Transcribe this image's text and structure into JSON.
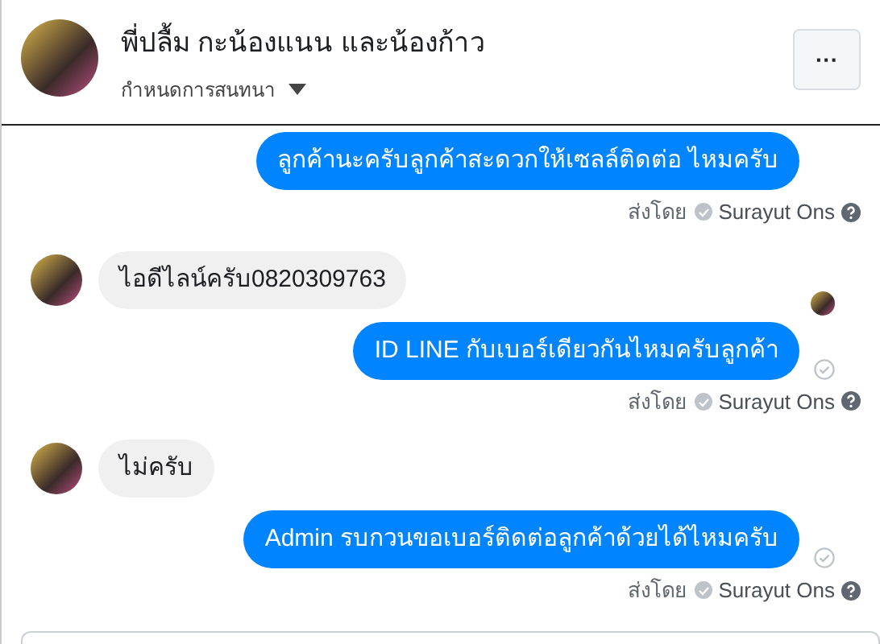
{
  "header": {
    "title": "พี่ปลื้ม กะน้องแนน และน้องก้าว",
    "subtitle": "กำหนดการสนทนา",
    "more_label": "···"
  },
  "messages": [
    {
      "kind": "outgoing",
      "text": "ลูกค้านะครับลูกค้าสะดวกให้เซลล์ติดต่อ ไหมครับ",
      "delivered": false,
      "sent_by": {
        "label": "ส่งโดย",
        "name": "Surayut Ons"
      }
    },
    {
      "kind": "incoming",
      "text": "ไอดีไลน์ครับ0820309763",
      "seen_avatar": true
    },
    {
      "kind": "outgoing",
      "text": "ID LINE กับเบอร์เดียวกันไหมครับลูกค้า",
      "delivered": true,
      "sent_by": {
        "label": "ส่งโดย",
        "name": "Surayut Ons"
      }
    },
    {
      "kind": "incoming",
      "text": "ไม่ครับ",
      "seen_avatar": false
    },
    {
      "kind": "outgoing",
      "text": "Admin รบกวนขอเบอร์ติดต่อลูกค้าด้วยได้ไหมครับ",
      "delivered": true,
      "sent_by": {
        "label": "ส่งโดย",
        "name": "Surayut Ons"
      }
    }
  ]
}
